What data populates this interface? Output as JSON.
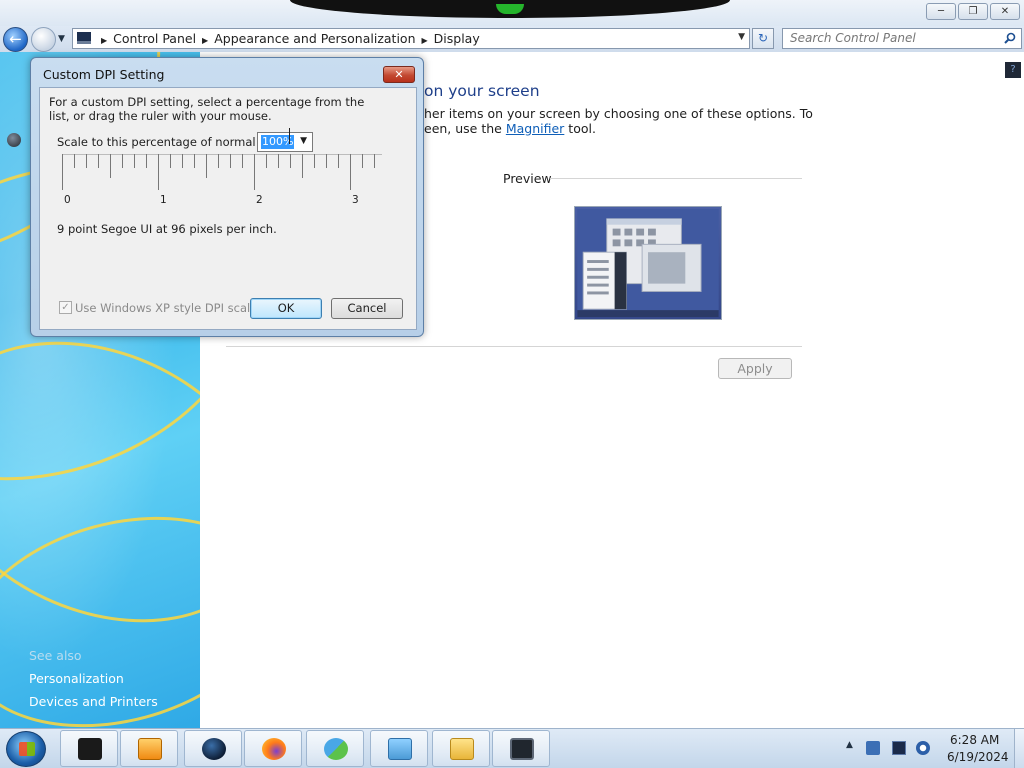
{
  "window": {
    "breadcrumbs": [
      "Control Panel",
      "Appearance and Personalization",
      "Display"
    ],
    "search_placeholder": "Search Control Panel"
  },
  "sidebar": {
    "see_also": "See also",
    "links": [
      "Personalization",
      "Devices and Printers"
    ]
  },
  "main": {
    "heading": "on your screen",
    "desc_line1": "her items on your screen by choosing one of these options. To",
    "desc_line2_prefix": "een, use the ",
    "magnifier_link": "Magnifier",
    "desc_line2_suffix": " tool.",
    "preview_label": "Preview",
    "apply_label": "Apply"
  },
  "dialog": {
    "title": "Custom DPI Setting",
    "intro": "For a custom DPI setting, select a percentage from the list, or drag the ruler with your mouse.",
    "scale_label": "Scale to this percentage of normal size:",
    "scale_value": "100%",
    "ruler_numbers": [
      "0",
      "1",
      "2",
      "3"
    ],
    "font_desc": "9 point Segoe UI at 96 pixels per inch.",
    "xp_checkbox_label": "Use Windows XP style DPI scaling",
    "xp_checked": true,
    "ok_label": "OK",
    "cancel_label": "Cancel"
  },
  "taskbar": {
    "time": "6:28 AM",
    "date": "6/19/2024",
    "items": [
      "terminal-app-icon",
      "media-player-icon",
      "dark-globe-icon",
      "firefox-icon",
      "people-icon",
      "control-panel-icon",
      "file-explorer-icon",
      "display-icon"
    ]
  },
  "colors": {
    "accent": "#1e3f8a",
    "link": "#0f5fb8",
    "wallpaper": "#38b6ea"
  }
}
